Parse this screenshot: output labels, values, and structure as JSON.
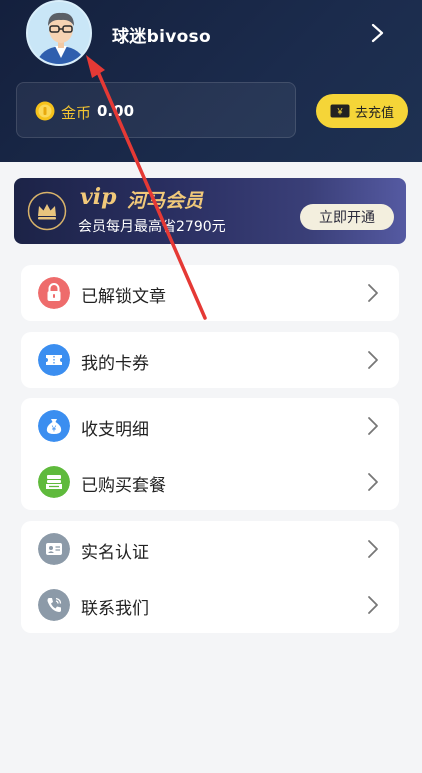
{
  "profile": {
    "username": "球迷bivoso"
  },
  "coins": {
    "label": "金币",
    "value": "0.00"
  },
  "recharge": {
    "label": "去充值"
  },
  "vip": {
    "brand": "vip",
    "title": "河马会员",
    "subtitle": "会员每月最高省2790元",
    "button": "立即开通"
  },
  "menu": {
    "unlocked_articles": "已解锁文章",
    "my_coupons": "我的卡券",
    "transactions": "收支明细",
    "purchased_plans": "已购买套餐",
    "real_name": "实名认证",
    "contact_us": "联系我们"
  },
  "colors": {
    "header_bg": "#1b2b4c",
    "accent_yellow": "#f5d538",
    "vip_gold": "#f1c97a",
    "lock_red": "#ee6c6c",
    "blue": "#3b8ef0",
    "green": "#5fba3c",
    "gray": "#8c9aa8",
    "arrow_red": "#e53935"
  }
}
